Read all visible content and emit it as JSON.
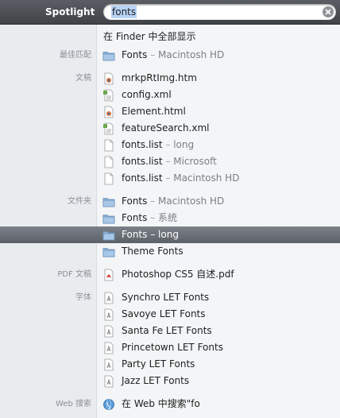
{
  "header": {
    "title": "Spotlight",
    "query": "fonts"
  },
  "top_hit": {
    "label": "在 Finder 中全部显示"
  },
  "sections": [
    {
      "category": "最佳匹配",
      "rows": [
        {
          "icon": "folder-icon",
          "name": "Fonts",
          "loc": "Macintosh HD"
        }
      ]
    },
    {
      "category": "文稿",
      "rows": [
        {
          "icon": "html-document-icon",
          "name": "mrkpRtImg.htm",
          "loc": ""
        },
        {
          "icon": "xml-document-icon",
          "name": "config.xml",
          "loc": ""
        },
        {
          "icon": "html-document-icon",
          "name": "Element.html",
          "loc": ""
        },
        {
          "icon": "xml-document-icon",
          "name": "featureSearch.xml",
          "loc": ""
        },
        {
          "icon": "blank-document-icon",
          "name": "fonts.list",
          "loc": "long"
        },
        {
          "icon": "blank-document-icon",
          "name": "fonts.list",
          "loc": "Microsoft"
        },
        {
          "icon": "blank-document-icon",
          "name": "fonts.list",
          "loc": "Macintosh HD"
        }
      ]
    },
    {
      "category": "文件夹",
      "rows": [
        {
          "icon": "folder-icon",
          "name": "Fonts",
          "loc": "Macintosh HD"
        },
        {
          "icon": "folder-icon",
          "name": "Fonts",
          "loc": "系统"
        },
        {
          "icon": "folder-icon",
          "name": "Fonts",
          "loc": "long",
          "selected": true
        },
        {
          "icon": "folder-icon",
          "name": "Theme Fonts",
          "loc": ""
        }
      ]
    },
    {
      "category": "PDF 文稿",
      "rows": [
        {
          "icon": "pdf-document-icon",
          "name": "Photoshop CS5 自述.pdf",
          "loc": ""
        }
      ]
    },
    {
      "category": "字体",
      "rows": [
        {
          "icon": "font-file-icon",
          "name": "Synchro LET Fonts",
          "loc": ""
        },
        {
          "icon": "font-file-icon",
          "name": "Savoye LET Fonts",
          "loc": ""
        },
        {
          "icon": "font-file-icon",
          "name": "Santa Fe LET Fonts",
          "loc": ""
        },
        {
          "icon": "font-file-icon",
          "name": "Princetown LET Fonts",
          "loc": ""
        },
        {
          "icon": "font-file-icon",
          "name": "Party LET Fonts",
          "loc": ""
        },
        {
          "icon": "font-file-icon",
          "name": "Jazz LET Fonts",
          "loc": ""
        }
      ]
    },
    {
      "category": "Web 搜索",
      "rows": [
        {
          "icon": "globe-icon",
          "name": "在 Web 中搜索\"fo",
          "loc": ""
        }
      ]
    }
  ],
  "colors": {
    "selection": "#676c73",
    "header": "#4b4e53",
    "search_highlight": "#b7d4f6"
  }
}
